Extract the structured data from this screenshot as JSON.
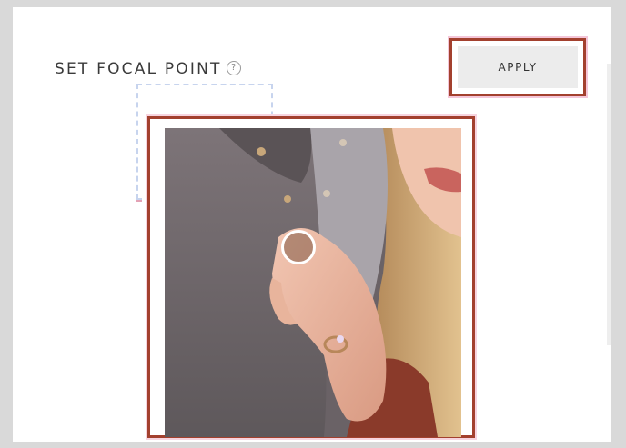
{
  "dialog": {
    "title": "SET FOCAL POINT",
    "help_icon": "question-circle-icon",
    "help_glyph": "?",
    "apply_label": "APPLY"
  },
  "image": {
    "description_icon": "photo-couple-hand-ring"
  },
  "colors": {
    "highlight_border": "#a3402e",
    "apply_bg": "#ececec",
    "panel_bg": "#ffffff",
    "page_bg": "#d9d9d9"
  }
}
